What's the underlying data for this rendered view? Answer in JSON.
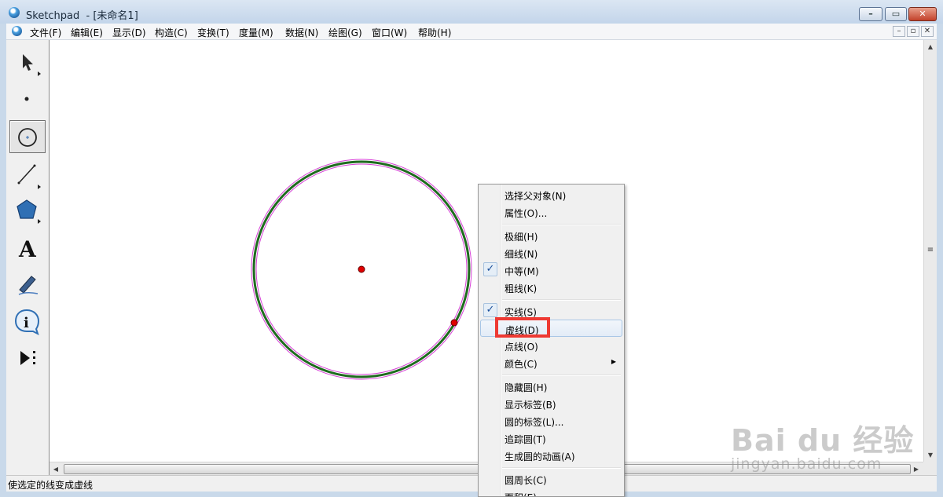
{
  "window": {
    "title": "Sketchpad  - [未命名1]"
  },
  "menubar": {
    "items": [
      "文件(F)",
      "编辑(E)",
      "显示(D)",
      "构造(C)",
      "变换(T)",
      "度量(M)",
      "数据(N)",
      "绘图(G)",
      "窗口(W)",
      "帮助(H)"
    ]
  },
  "toolbox": {
    "tools": [
      "arrow-select-tool",
      "point-tool",
      "compass-tool",
      "straightedge-tool",
      "polygon-tool",
      "text-tool",
      "marker-tool",
      "information-tool",
      "custom-tool"
    ],
    "selected": "compass-tool"
  },
  "canvas": {
    "circle_stroke_color": "#1e6b1e",
    "selection_halo_color": "#d640d6",
    "point_color": "#e00000"
  },
  "context_menu": {
    "items": [
      {
        "label": "选择父对象(N)",
        "checked": false,
        "submenu": false
      },
      {
        "label": "属性(O)...",
        "checked": false,
        "submenu": false
      },
      {
        "label": "极细(H)",
        "checked": false,
        "submenu": false
      },
      {
        "label": "细线(N)",
        "checked": false,
        "submenu": false
      },
      {
        "label": "中等(M)",
        "checked": true,
        "submenu": false
      },
      {
        "label": "粗线(K)",
        "checked": false,
        "submenu": false
      },
      {
        "label": "实线(S)",
        "checked": true,
        "submenu": false
      },
      {
        "label": "虚线(D)",
        "checked": false,
        "submenu": false,
        "hover": true
      },
      {
        "label": "点线(O)",
        "checked": false,
        "submenu": false
      },
      {
        "label": "颜色(C)",
        "checked": false,
        "submenu": true
      },
      {
        "label": "隐藏圆(H)",
        "checked": false,
        "submenu": false
      },
      {
        "label": "显示标签(B)",
        "checked": false,
        "submenu": false
      },
      {
        "label": "圆的标签(L)...",
        "checked": false,
        "submenu": false
      },
      {
        "label": "追踪圆(T)",
        "checked": false,
        "submenu": false
      },
      {
        "label": "生成圆的动画(A)",
        "checked": false,
        "submenu": false
      },
      {
        "label": "圆周长(C)",
        "checked": false,
        "submenu": false
      },
      {
        "label": "面积(E)",
        "checked": false,
        "submenu": false
      }
    ],
    "highlight_color": "#ee3a33"
  },
  "statusbar": {
    "text": "使选定的线变成虚线"
  },
  "watermark": {
    "logo": "Bai du 经验",
    "url": "jingyan.baidu.com"
  }
}
